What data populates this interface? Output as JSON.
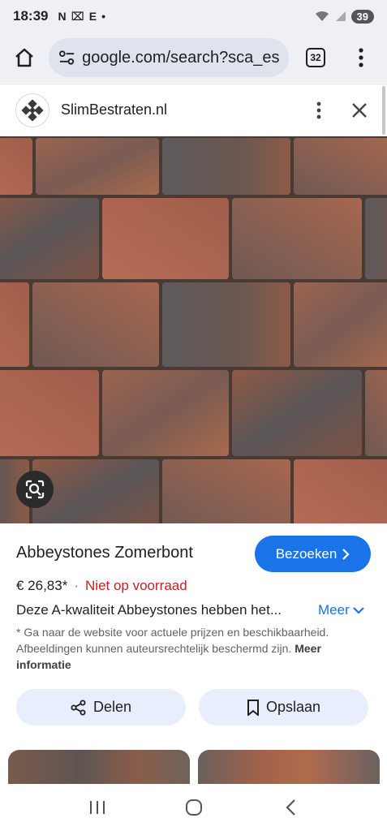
{
  "status": {
    "time": "18:39",
    "icons": [
      "N",
      "⌧",
      "E",
      "•"
    ],
    "battery": "39"
  },
  "browser": {
    "url": "google.com/search?sca_esv",
    "tab_count": "32"
  },
  "site": {
    "name": "SlimBestraten.nl"
  },
  "product": {
    "title": "Abbeystones Zomerbont",
    "visit_label": "Bezoeken",
    "price": "€ 26,83*",
    "separator": "·",
    "stock": "Niet op voorraad",
    "description": "Deze A-kwaliteit Abbeystones hebben het...",
    "more_label": "Meer",
    "disclaimer": "* Ga naar de website voor actuele prijzen en beschikbaarheid. Afbeeldingen kunnen auteursrechtelijk beschermd zijn.",
    "disclaimer_link": "Meer informatie",
    "share_label": "Delen",
    "save_label": "Opslaan"
  },
  "colors": {
    "accent": "#1a73e8",
    "out_of_stock": "#c5221f",
    "pill_bg": "#e8eefb"
  }
}
